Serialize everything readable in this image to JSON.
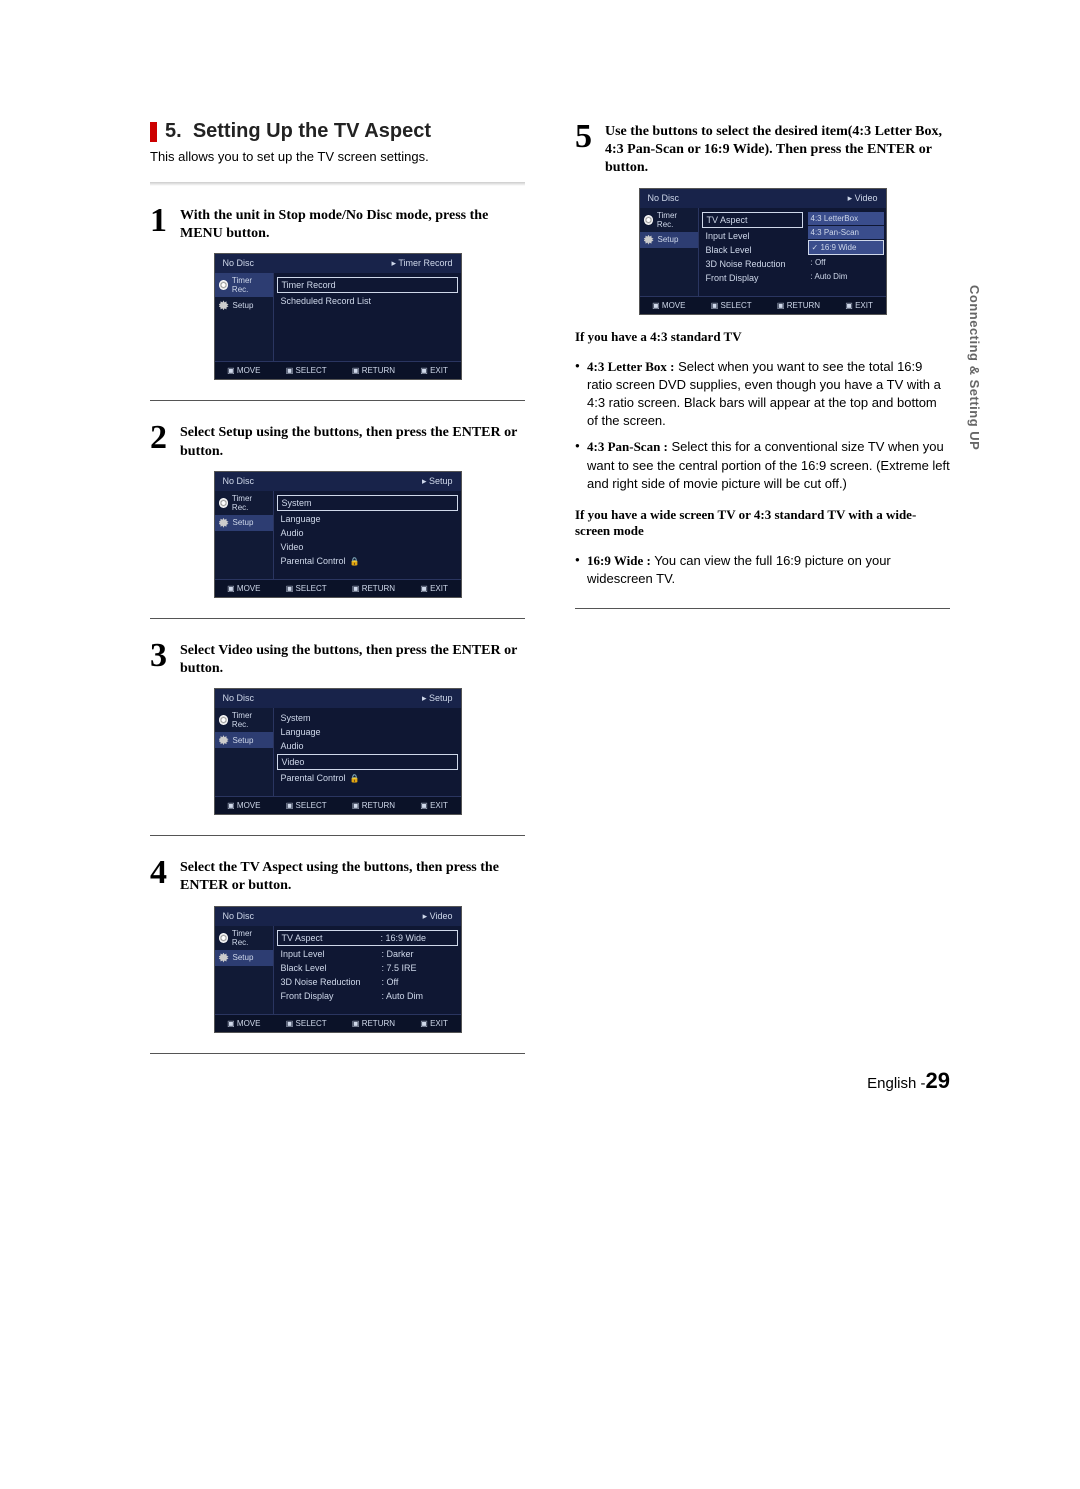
{
  "heading": {
    "number": "5.",
    "title": "Setting Up the TV Aspect"
  },
  "intro": "This allows you to set up the TV screen settings.",
  "steps": {
    "1": {
      "num": "1",
      "text": "With the unit in Stop mode/No Disc mode, press the MENU button."
    },
    "2": {
      "num": "2",
      "text": "Select Setup using the          buttons, then press the ENTER or       button."
    },
    "3": {
      "num": "3",
      "text": "Select Video using the          buttons, then press the ENTER or       button."
    },
    "4": {
      "num": "4",
      "text": "Select the TV Aspect using the          buttons, then press the ENTER or       button."
    },
    "5": {
      "num": "5",
      "text": "Use the          buttons to select the desired item(4:3 Letter Box, 4:3 Pan-Scan or 16:9 Wide). Then press the ENTER or       button."
    }
  },
  "osd_common": {
    "no_disc": "No Disc",
    "side_timer": "Timer Rec.",
    "side_setup": "Setup",
    "nav_move": "MOVE",
    "nav_select": "SELECT",
    "nav_return": "RETURN",
    "nav_exit": "EXIT"
  },
  "osd1": {
    "crumb": "Timer Record",
    "r1": "Timer Record",
    "r2": "Scheduled Record List"
  },
  "osd2": {
    "crumb": "Setup",
    "r1": "System",
    "r2": "Language",
    "r3": "Audio",
    "r4": "Video",
    "r5": "Parental Control"
  },
  "osd3": {
    "crumb": "Setup",
    "r1": "System",
    "r2": "Language",
    "r3": "Audio",
    "r4": "Video",
    "r5": "Parental Control"
  },
  "osd4": {
    "crumb": "Video",
    "rows": {
      "tv_aspect": {
        "lbl": "TV Aspect",
        "val": ": 16:9 Wide"
      },
      "input_level": {
        "lbl": "Input Level",
        "val": ": Darker"
      },
      "black_level": {
        "lbl": "Black Level",
        "val": ": 7.5 IRE"
      },
      "nr": {
        "lbl": "3D Noise Reduction",
        "val": ": Off"
      },
      "front": {
        "lbl": "Front Display",
        "val": ": Auto Dim"
      }
    }
  },
  "osd5": {
    "crumb": "Video",
    "rows": {
      "tv_aspect": "TV Aspect",
      "input_level": "Input Level",
      "black_level": "Black Level",
      "nr": "3D Noise Reduction",
      "front": "Front Display"
    },
    "opts": {
      "o1": "4:3 LetterBox",
      "o2": "4:3 Pan-Scan",
      "o3": "16:9 Wide",
      "o4": ": Off",
      "o5": ": Auto Dim"
    }
  },
  "right": {
    "sub1": "If you have a 4:3 standard TV",
    "li1a": "4:3 Letter Box :",
    "li1b": " Select when you want to see the total 16:9 ratio screen DVD supplies, even though you have a TV with a 4:3 ratio screen. Black bars will appear at the top and bottom of the screen.",
    "li2a": "4:3 Pan-Scan :",
    "li2b": " Select this for a conventional size TV when you want to see the central portion of the 16:9 screen. (Extreme left and right side of movie picture will be cut off.)",
    "sub2": "If you have a wide screen TV or 4:3 standard TV with a wide-screen mode",
    "li3a": "16:9 Wide :",
    "li3b": " You can view the full 16:9 picture on your widescreen TV."
  },
  "sidetab": "Connecting & Setting UP",
  "footer": {
    "lang": "English -",
    "page": "29"
  }
}
